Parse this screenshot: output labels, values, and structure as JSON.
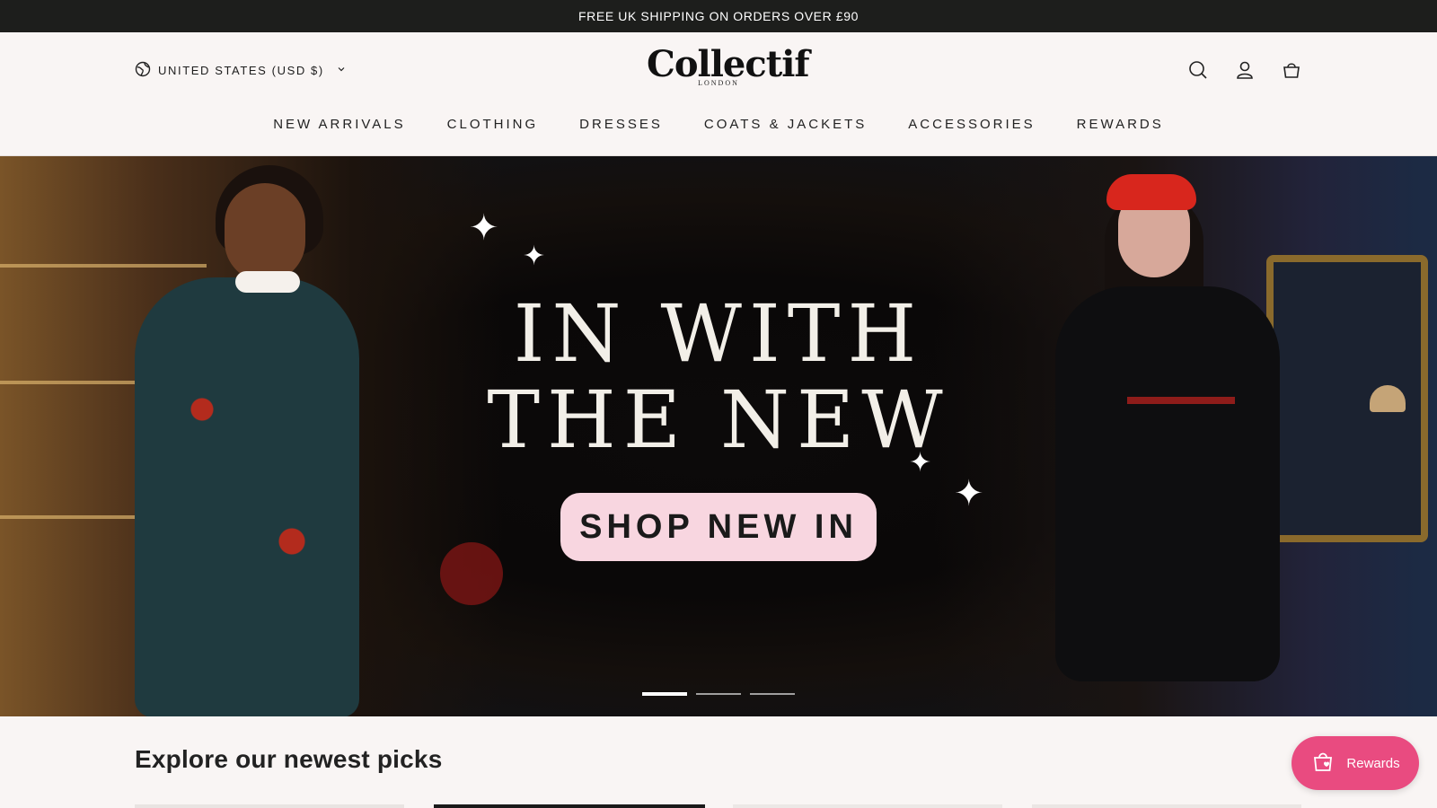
{
  "announcement": {
    "text": "FREE UK SHIPPING ON ORDERS OVER £90"
  },
  "header": {
    "locale_label": "UNITED STATES (USD $)",
    "logo_word": "Collectif",
    "logo_sub": "LONDON",
    "icons": [
      "search-icon",
      "account-icon",
      "cart-icon"
    ]
  },
  "nav": {
    "items": [
      {
        "label": "NEW ARRIVALS"
      },
      {
        "label": "CLOTHING"
      },
      {
        "label": "DRESSES"
      },
      {
        "label": "COATS & JACKETS"
      },
      {
        "label": "ACCESSORIES"
      },
      {
        "label": "REWARDS"
      }
    ]
  },
  "hero": {
    "headline_line1": "IN WITH",
    "headline_line2": "THE NEW",
    "cta_label": "SHOP NEW IN",
    "slides_total": 3,
    "active_slide": 1
  },
  "section": {
    "title": "Explore our newest picks"
  },
  "rewards_widget": {
    "label": "Rewards"
  },
  "colors": {
    "announcement_bg": "#1d1e1c",
    "page_bg": "#f9f5f4",
    "cta_bg": "#f8d6e0",
    "rewards_bg": "#e94b80"
  }
}
